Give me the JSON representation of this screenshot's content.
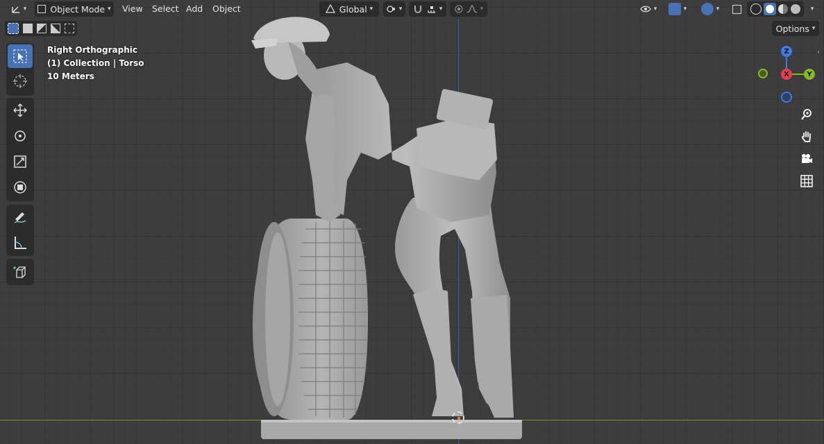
{
  "header": {
    "mode_label": "Object Mode",
    "menus": [
      "View",
      "Select",
      "Add",
      "Object"
    ],
    "transform_orientation": "Global",
    "options_label": "Options"
  },
  "overlay": {
    "view_name": "Right Orthographic",
    "collection": "(1) Collection | Torso",
    "scale": "10 Meters"
  },
  "gizmo": {
    "z_label": "Z",
    "x_label": "X",
    "y_label": "Y",
    "colors": {
      "x": "#ee3b50",
      "y": "#86bb1c",
      "z": "#3b7ce6",
      "neg_y": "#9acd32"
    }
  },
  "tools": [
    "select-box-icon",
    "cursor-icon",
    "move-icon",
    "rotate-icon",
    "scale-icon",
    "transform-icon",
    "annotate-icon",
    "measure-icon",
    "add-cube-icon"
  ],
  "colors": {
    "active_tool": "#4772b3",
    "accent": "#4772b3"
  }
}
